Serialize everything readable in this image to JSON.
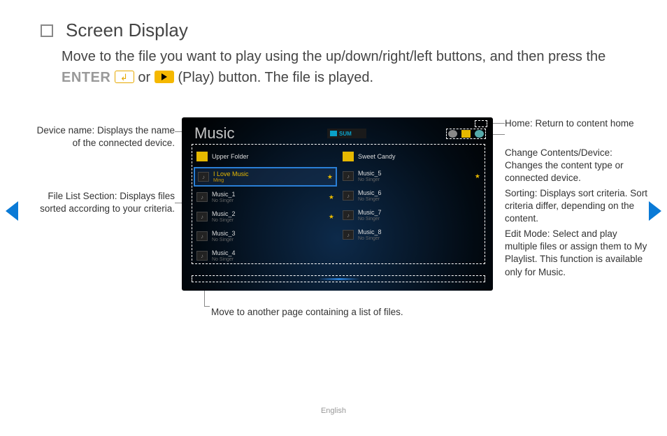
{
  "title": "Screen Display",
  "body": {
    "pre": "Move to the file you want to play using the up/down/right/left buttons, and then press the ",
    "enter_label": "ENTER",
    "or": " or ",
    "post": " (Play) button. The file is played."
  },
  "tv": {
    "section": "Music",
    "device_label": "SUM",
    "upper_folder": "Upper Folder",
    "col1": [
      {
        "title": "I Love Music",
        "sub": "Ming",
        "selected": true,
        "star": true
      },
      {
        "title": "Music_1",
        "sub": "No Singer",
        "star": true
      },
      {
        "title": "Music_2",
        "sub": "No Singer",
        "star": true
      },
      {
        "title": "Music_3",
        "sub": "No Singer"
      },
      {
        "title": "Music_4",
        "sub": "No Singer"
      }
    ],
    "col2_header": "Sweet Candy",
    "col2": [
      {
        "title": "Music_5",
        "sub": "No Singer",
        "star": true
      },
      {
        "title": "Music_6",
        "sub": "No Singer"
      },
      {
        "title": "Music_7",
        "sub": "No Singer"
      },
      {
        "title": "Music_8",
        "sub": "No Singer"
      }
    ]
  },
  "callouts": {
    "device_name": "Device name: Displays the name of the connected device.",
    "file_list": "File List Section: Displays files sorted according to your criteria.",
    "home": "Home: Return to content home",
    "change": "Change Contents/Device: Changes the content type or connected device.",
    "sorting": "Sorting: Displays sort criteria. Sort criteria differ, depending on the content.",
    "edit": "Edit Mode: Select and play multiple files or assign them to My Playlist. This function is available only for Music.",
    "page": "Move to another page containing a list of files."
  },
  "footer": "English"
}
